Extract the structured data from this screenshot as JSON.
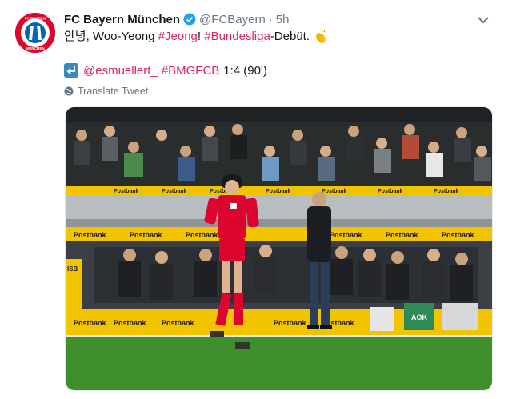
{
  "tweet": {
    "author_name": "FC Bayern München",
    "author_handle": "@FCBayern",
    "separator": "·",
    "time": "5h",
    "text_prefix": "안녕, Woo-Yeong ",
    "hashtag_1": "#Jeong",
    "text_middle": "! ",
    "hashtag_2": "#Bundesliga",
    "text_suffix": "-Debüt.",
    "emoji_name": "clapping-hands",
    "quote_mention": "@esmuellert_",
    "quote_hashtag": "#BMGFCB",
    "quote_score": "1:4 (90')",
    "translate_label": "Translate Tweet",
    "avatar_text_top": "FC BAYERN",
    "avatar_text_bottom": "MÜNCHEN"
  },
  "photo": {
    "description_icon": "football-player-photo",
    "banner_brand": "Postbank",
    "bench_brand": "ISB",
    "board_right": "AOK"
  },
  "colors": {
    "brand_red": "#dc052d",
    "hashtag": "#e0245e",
    "secondary_text": "#657786",
    "verified_blue": "#1da1f2",
    "board_yellow": "#f2c400"
  }
}
